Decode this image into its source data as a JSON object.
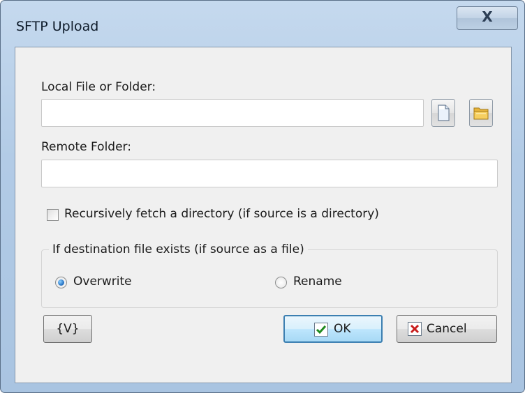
{
  "dialog": {
    "title": "SFTP Upload",
    "close_glyph": "X"
  },
  "local": {
    "label": "Local File or Folder:",
    "value": "",
    "file_button_icon": "file-icon",
    "folder_button_icon": "folder-icon"
  },
  "remote": {
    "label": "Remote Folder:",
    "value": ""
  },
  "recursive": {
    "label": "Recursively fetch a directory (if source is a directory)",
    "checked": false
  },
  "exists_group": {
    "legend": "If destination file exists (if source as a file)",
    "options": [
      {
        "label": "Overwrite",
        "selected": true
      },
      {
        "label": "Rename",
        "selected": false
      }
    ]
  },
  "buttons": {
    "variables": "{V}",
    "ok": "OK",
    "cancel": "Cancel"
  },
  "colors": {
    "accent": "#3c7fb1",
    "ok_check": "#1f8a1f",
    "cancel_x": "#c81d1d",
    "folder": "#e8b43a"
  }
}
